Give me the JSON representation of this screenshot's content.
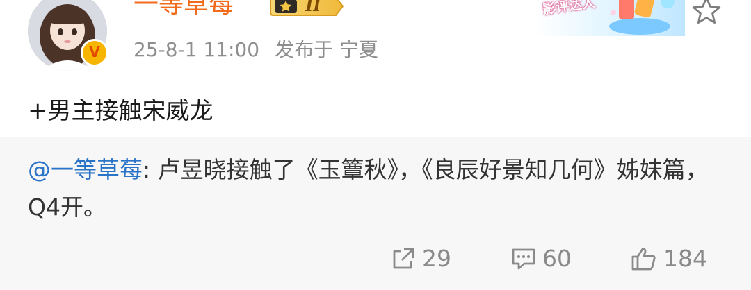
{
  "post": {
    "username": "一等草莓",
    "level": "II",
    "timestamp": "25-8-1 11:00",
    "location": "发布于 宁夏",
    "decor_label": "影评达人",
    "text": "+男主接触宋威龙"
  },
  "repost": {
    "mention": "@一等草莓",
    "text": ": 卢昱晓接触了《玉簟秋》，《良辰好景知几何》姊妹篇，Q4开。"
  },
  "actions": {
    "share_count": "29",
    "comment_count": "60",
    "like_count": "184"
  },
  "colors": {
    "username": "#f26b1d",
    "mention": "#2a74c8",
    "meta": "#8e8e8e",
    "repost_bg": "#f7f7f7"
  },
  "icons": {
    "avatar": "avatar",
    "verified": "verified-v-icon",
    "favorite": "star-icon",
    "share": "share-icon",
    "comment": "comment-icon",
    "like": "thumbs-up-icon"
  }
}
